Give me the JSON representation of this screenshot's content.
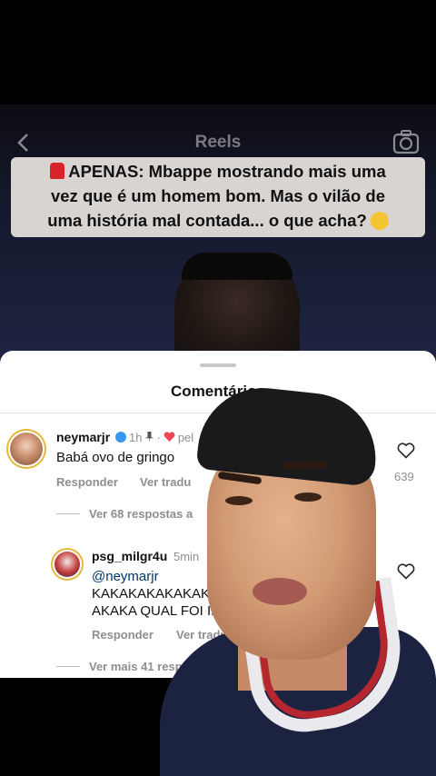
{
  "reel": {
    "title": "Reels",
    "headline_line1": "APENAS: Mbappe mostrando mais uma",
    "headline_line2": "vez que é um homem bom. Mas o vilão de",
    "headline_line3": "uma história mal contada... o que acha?"
  },
  "comments_sheet": {
    "title": "Comentários",
    "comments": [
      {
        "username": "neymarjr",
        "time": "1h",
        "liked_by": "pel",
        "text": "Babá ovo de gringo",
        "reply_label": "Responder",
        "translate_label": "Ver tradu",
        "likes": "639",
        "view_replies": "Ver 68 respostas a"
      },
      {
        "username": "psg_milgr4u",
        "time": "5min",
        "mention": "@neymarjr",
        "text_line1": "KAKAKAKAKAKAKA",
        "text_line2": "AKAKA QUAL FOI IDO",
        "reply_label": "Responder",
        "translate_label": "Ver traduçã",
        "view_replies": "Ver mais 41 respo"
      }
    ]
  },
  "colors": {
    "accent_blue": "#3897f0",
    "like_red": "#ed4956",
    "headline_bg": "#d8d4d2"
  }
}
